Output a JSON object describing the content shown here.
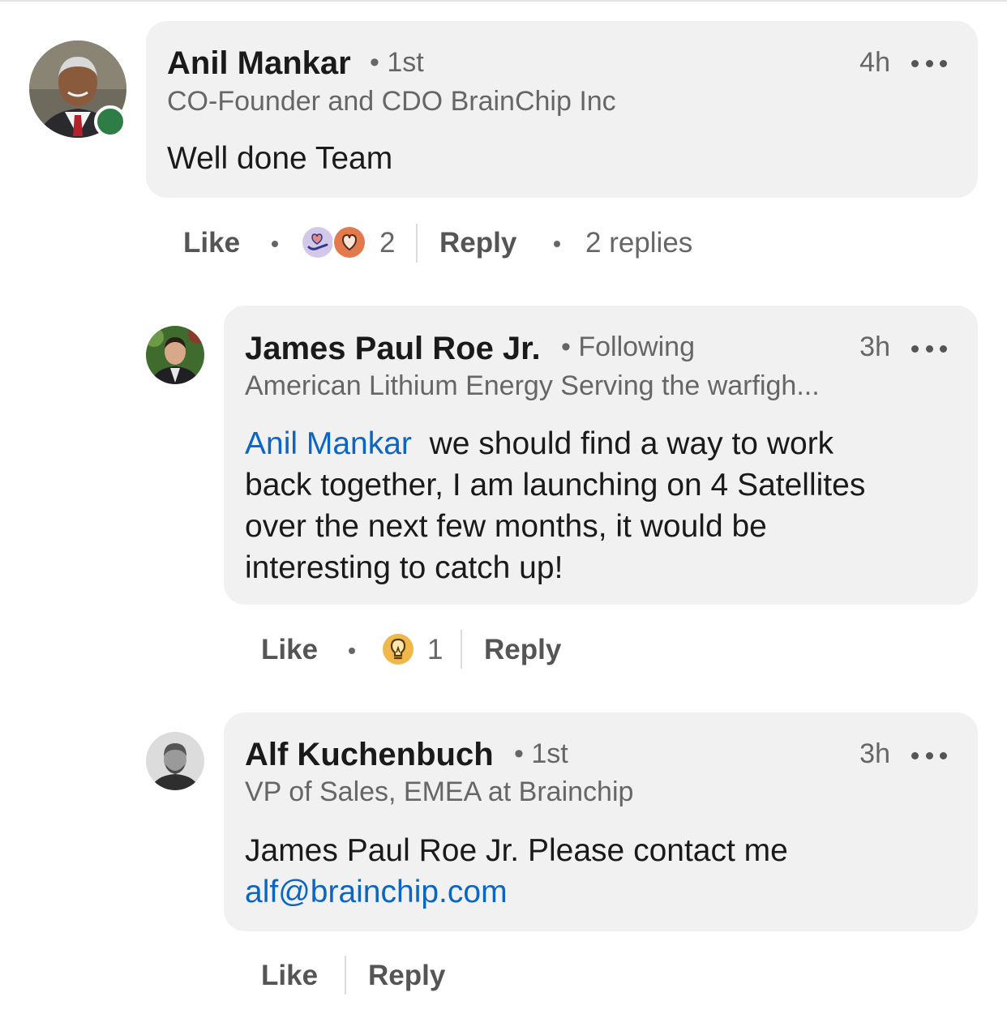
{
  "comments": [
    {
      "author": "Anil Mankar",
      "degree": "1st",
      "time": "4h",
      "headline": "CO-Founder and CDO BrainChip Inc",
      "body": "Well done Team",
      "actions": {
        "like": "Like",
        "reaction_count": "2",
        "reply": "Reply",
        "replies": "2 replies"
      },
      "reactions": [
        "support-icon",
        "love-icon"
      ]
    },
    {
      "author": "James Paul Roe Jr.",
      "degree": "Following",
      "time": "3h",
      "headline": "American Lithium Energy Serving the warfigh...",
      "mention": "Anil Mankar",
      "body_lines": [
        "we should find a way to work",
        "back together, I am launching on 4 Satellites",
        "over the next few months, it would be",
        "interesting to catch up!"
      ],
      "actions": {
        "like": "Like",
        "reaction_count": "1",
        "reply": "Reply"
      },
      "reactions": [
        "insightful-icon"
      ]
    },
    {
      "author": "Alf Kuchenbuch",
      "degree": "1st",
      "time": "3h",
      "headline": "VP of Sales, EMEA at Brainchip",
      "body_line1": "James Paul Roe Jr. Please contact me",
      "email": "alf@brainchip.com",
      "actions": {
        "like": "Like",
        "reply": "Reply"
      }
    }
  ],
  "colors": {
    "link": "#0a66c2",
    "presence": "#2e7d46",
    "bubble": "#f1f1f1"
  }
}
